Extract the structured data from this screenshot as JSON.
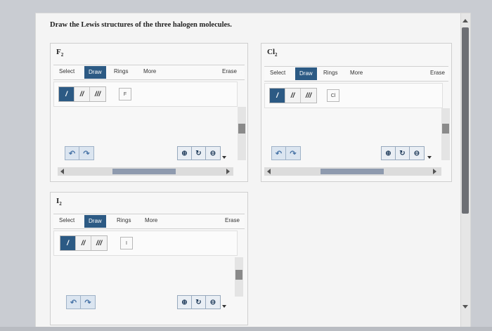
{
  "question": {
    "title": "Draw the Lewis structures of the three halogen molecules."
  },
  "toolbar_labels": {
    "select": "Select",
    "draw": "Draw",
    "rings": "Rings",
    "more": "More",
    "erase": "Erase"
  },
  "bond_tools": [
    "/",
    "//",
    "///"
  ],
  "panels": {
    "f2": {
      "label": "F",
      "sub": "2",
      "element_button": "F"
    },
    "cl2": {
      "label": "Cl",
      "sub": "2",
      "element_button": "Cl"
    },
    "i2": {
      "label": "I",
      "sub": "2",
      "element_button": "I"
    }
  },
  "icons": {
    "undo": "undo-icon",
    "redo": "redo-icon",
    "zoom_in": "zoom-in-icon",
    "zoom_reset": "zoom-reset-icon",
    "zoom_out": "zoom-out-icon"
  },
  "colors": {
    "accent": "#2c5a84",
    "button_tint": "#dbe5f0"
  }
}
